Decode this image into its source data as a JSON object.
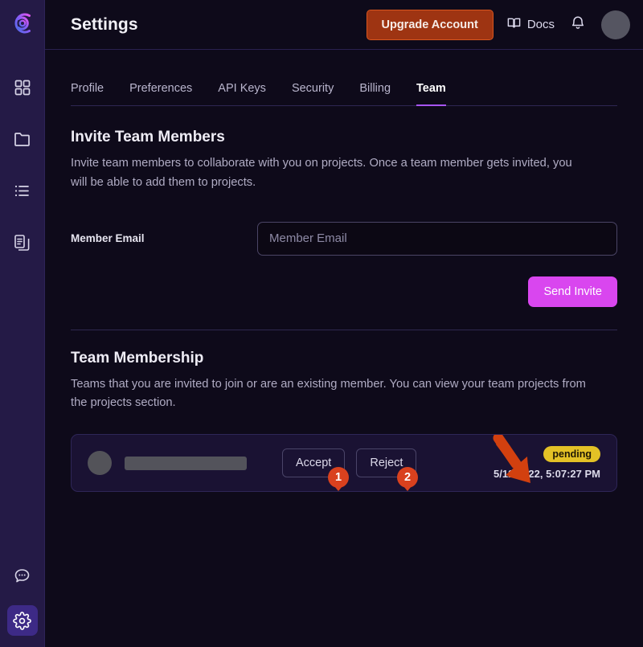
{
  "sidebar": {
    "logo": {
      "icon": "brand-logo-icon"
    },
    "items": [
      {
        "icon": "grid-dashboard-icon",
        "name": "dashboard",
        "active": false
      },
      {
        "icon": "folder-icon",
        "name": "projects",
        "active": false
      },
      {
        "icon": "list-icon",
        "name": "tasks",
        "active": false
      },
      {
        "icon": "documents-icon",
        "name": "documents",
        "active": false
      }
    ],
    "bottom_items": [
      {
        "icon": "chat-bubble-icon",
        "name": "support",
        "active": false
      },
      {
        "icon": "gear-icon",
        "name": "settings",
        "active": true
      }
    ]
  },
  "header": {
    "title": "Settings",
    "upgrade_label": "Upgrade Account",
    "docs_label": "Docs",
    "docs_icon": "book-icon",
    "bell_icon": "bell-icon",
    "avatar": "user-avatar"
  },
  "tabs": [
    {
      "label": "Profile",
      "active": false
    },
    {
      "label": "Preferences",
      "active": false
    },
    {
      "label": "API Keys",
      "active": false
    },
    {
      "label": "Security",
      "active": false
    },
    {
      "label": "Billing",
      "active": false
    },
    {
      "label": "Team",
      "active": true
    }
  ],
  "invite_section": {
    "title": "Invite Team Members",
    "description": "Invite team members to collaborate with you on projects. Once a team member gets invited, you will be able to add them to projects.",
    "email_label": "Member Email",
    "email_value": "",
    "email_placeholder": "Member Email",
    "send_label": "Send Invite"
  },
  "membership_section": {
    "title": "Team Membership",
    "description": "Teams that you are invited to join or are an existing member. You can view your team projects from the projects section.",
    "row": {
      "avatar": "member-avatar",
      "name_redacted": "",
      "accept_label": "Accept",
      "reject_label": "Reject",
      "status": "pending",
      "timestamp": "5/12/2022, 5:07:27 PM"
    }
  },
  "annotations": {
    "marker_1": "1",
    "marker_2": "2",
    "arrow": "arrow-pointing-to-status-badge"
  },
  "colors": {
    "background": "#0e0a1a",
    "sidebar": "#241a46",
    "accent_purple": "#a855f7",
    "send_invite": "#d946ef",
    "upgrade_bg": "#9e3412",
    "upgrade_border": "#d8561f",
    "badge_pending": "#e3c126",
    "annotation_orange": "#d9411e"
  }
}
